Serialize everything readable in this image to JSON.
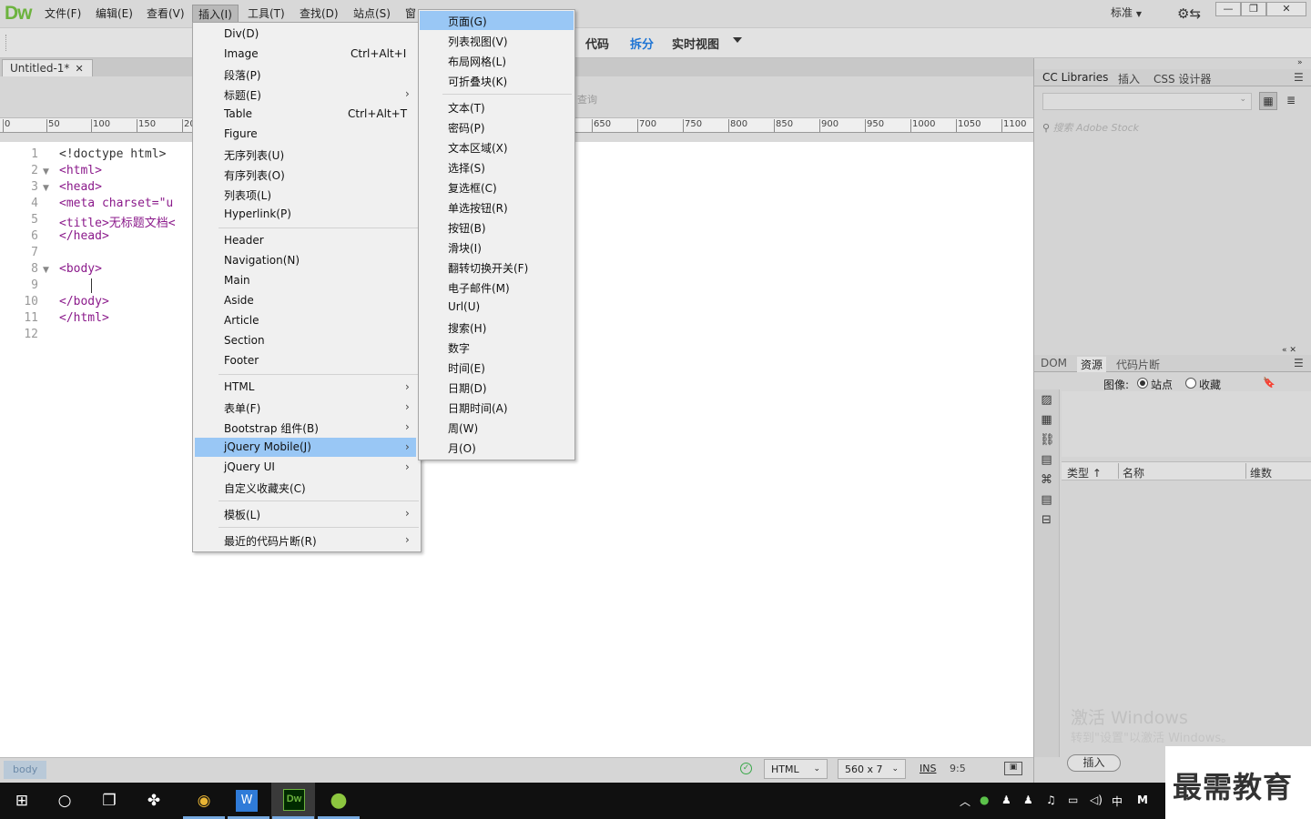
{
  "app": {
    "logo": "Dw"
  },
  "menubar": {
    "items": [
      {
        "label": "文件(F)"
      },
      {
        "label": "编辑(E)"
      },
      {
        "label": "查看(V)"
      },
      {
        "label": "插入(I)"
      },
      {
        "label": "工具(T)"
      },
      {
        "label": "查找(D)"
      },
      {
        "label": "站点(S)"
      },
      {
        "label": "窗"
      }
    ],
    "workspace": "标准",
    "window_controls": [
      "—",
      "❐",
      "✕"
    ]
  },
  "toolbar": {
    "views": [
      "代码",
      "拆分",
      "实时视图"
    ],
    "active_view": "拆分"
  },
  "document": {
    "tab_title": "Untitled-1*",
    "tab_close": "✕",
    "live_hint": "查询"
  },
  "ruler": {
    "labels": [
      "0",
      "50",
      "100",
      "150",
      "20",
      "650",
      "700",
      "750",
      "800",
      "850",
      "900",
      "950",
      "1000",
      "1050",
      "1100"
    ]
  },
  "code": {
    "line_numbers": [
      "1",
      "2",
      "3",
      "4",
      "5",
      "6",
      "7",
      "8",
      "9",
      "10",
      "11",
      "12"
    ],
    "lines": [
      "<!doctype html>",
      "<html>",
      "<head>",
      "<meta charset=\"u",
      "<title>无标题文档<",
      "</head>",
      "",
      "<body>",
      "",
      "</body>",
      "</html>",
      ""
    ]
  },
  "status": {
    "tag": "body",
    "doc_type": "HTML",
    "size": "560 x 7",
    "mode": "INS",
    "position": "9:5"
  },
  "insert_menu": {
    "items": [
      {
        "label": "Div(D)"
      },
      {
        "label": "Image",
        "shortcut": "Ctrl+Alt+I"
      },
      {
        "label": "段落(P)"
      },
      {
        "label": "标题(E)",
        "submenu": true
      },
      {
        "label": "Table",
        "shortcut": "Ctrl+Alt+T"
      },
      {
        "label": "Figure"
      },
      {
        "label": "无序列表(U)"
      },
      {
        "label": "有序列表(O)"
      },
      {
        "label": "列表项(L)"
      },
      {
        "label": "Hyperlink(P)"
      },
      {
        "label": "Header"
      },
      {
        "label": "Navigation(N)"
      },
      {
        "label": "Main"
      },
      {
        "label": "Aside"
      },
      {
        "label": "Article"
      },
      {
        "label": "Section"
      },
      {
        "label": "Footer"
      },
      {
        "label": "HTML",
        "submenu": true
      },
      {
        "label": "表单(F)",
        "submenu": true
      },
      {
        "label": "Bootstrap 组件(B)",
        "submenu": true
      },
      {
        "label": "jQuery Mobile(J)",
        "submenu": true,
        "highlighted": true
      },
      {
        "label": "jQuery UI",
        "submenu": true
      },
      {
        "label": "自定义收藏夹(C)"
      },
      {
        "label": "模板(L)",
        "submenu": true
      },
      {
        "label": "最近的代码片断(R)",
        "submenu": true
      }
    ],
    "submenu_arrow": "›"
  },
  "jqm_submenu": {
    "items": [
      {
        "label": "页面(G)",
        "highlighted": true
      },
      {
        "label": "列表视图(V)"
      },
      {
        "label": "布局网格(L)"
      },
      {
        "label": "可折叠块(K)"
      },
      {
        "label": "文本(T)"
      },
      {
        "label": "密码(P)"
      },
      {
        "label": "文本区域(X)"
      },
      {
        "label": "选择(S)"
      },
      {
        "label": "复选框(C)"
      },
      {
        "label": "单选按钮(R)"
      },
      {
        "label": "按钮(B)"
      },
      {
        "label": "滑块(I)"
      },
      {
        "label": "翻转切换开关(F)"
      },
      {
        "label": "电子邮件(M)"
      },
      {
        "label": "Url(U)"
      },
      {
        "label": "搜索(H)"
      },
      {
        "label": "数字"
      },
      {
        "label": "时间(E)"
      },
      {
        "label": "日期(D)"
      },
      {
        "label": "日期时间(A)"
      },
      {
        "label": "周(W)"
      },
      {
        "label": "月(O)"
      }
    ]
  },
  "panel_top": {
    "tabs": [
      "CC Libraries",
      "插入",
      "CSS 设计器"
    ],
    "search_placeholder": "搜索 Adobe Stock"
  },
  "panel_bottom": {
    "tabs": [
      "DOM",
      "资源",
      "代码片断"
    ],
    "active_tab": "资源",
    "image_label": "图像:",
    "radio_site": "站点",
    "radio_fav": "收藏",
    "columns": [
      "类型 ↑",
      "名称",
      "维数"
    ],
    "insert_button": "插入",
    "activate_title": "激活 Windows",
    "activate_sub": "转到\"设置\"以激活 Windows。"
  },
  "watermark": "最需教育",
  "taskbar": {
    "tray_ime": "中",
    "tray_m": "M"
  }
}
